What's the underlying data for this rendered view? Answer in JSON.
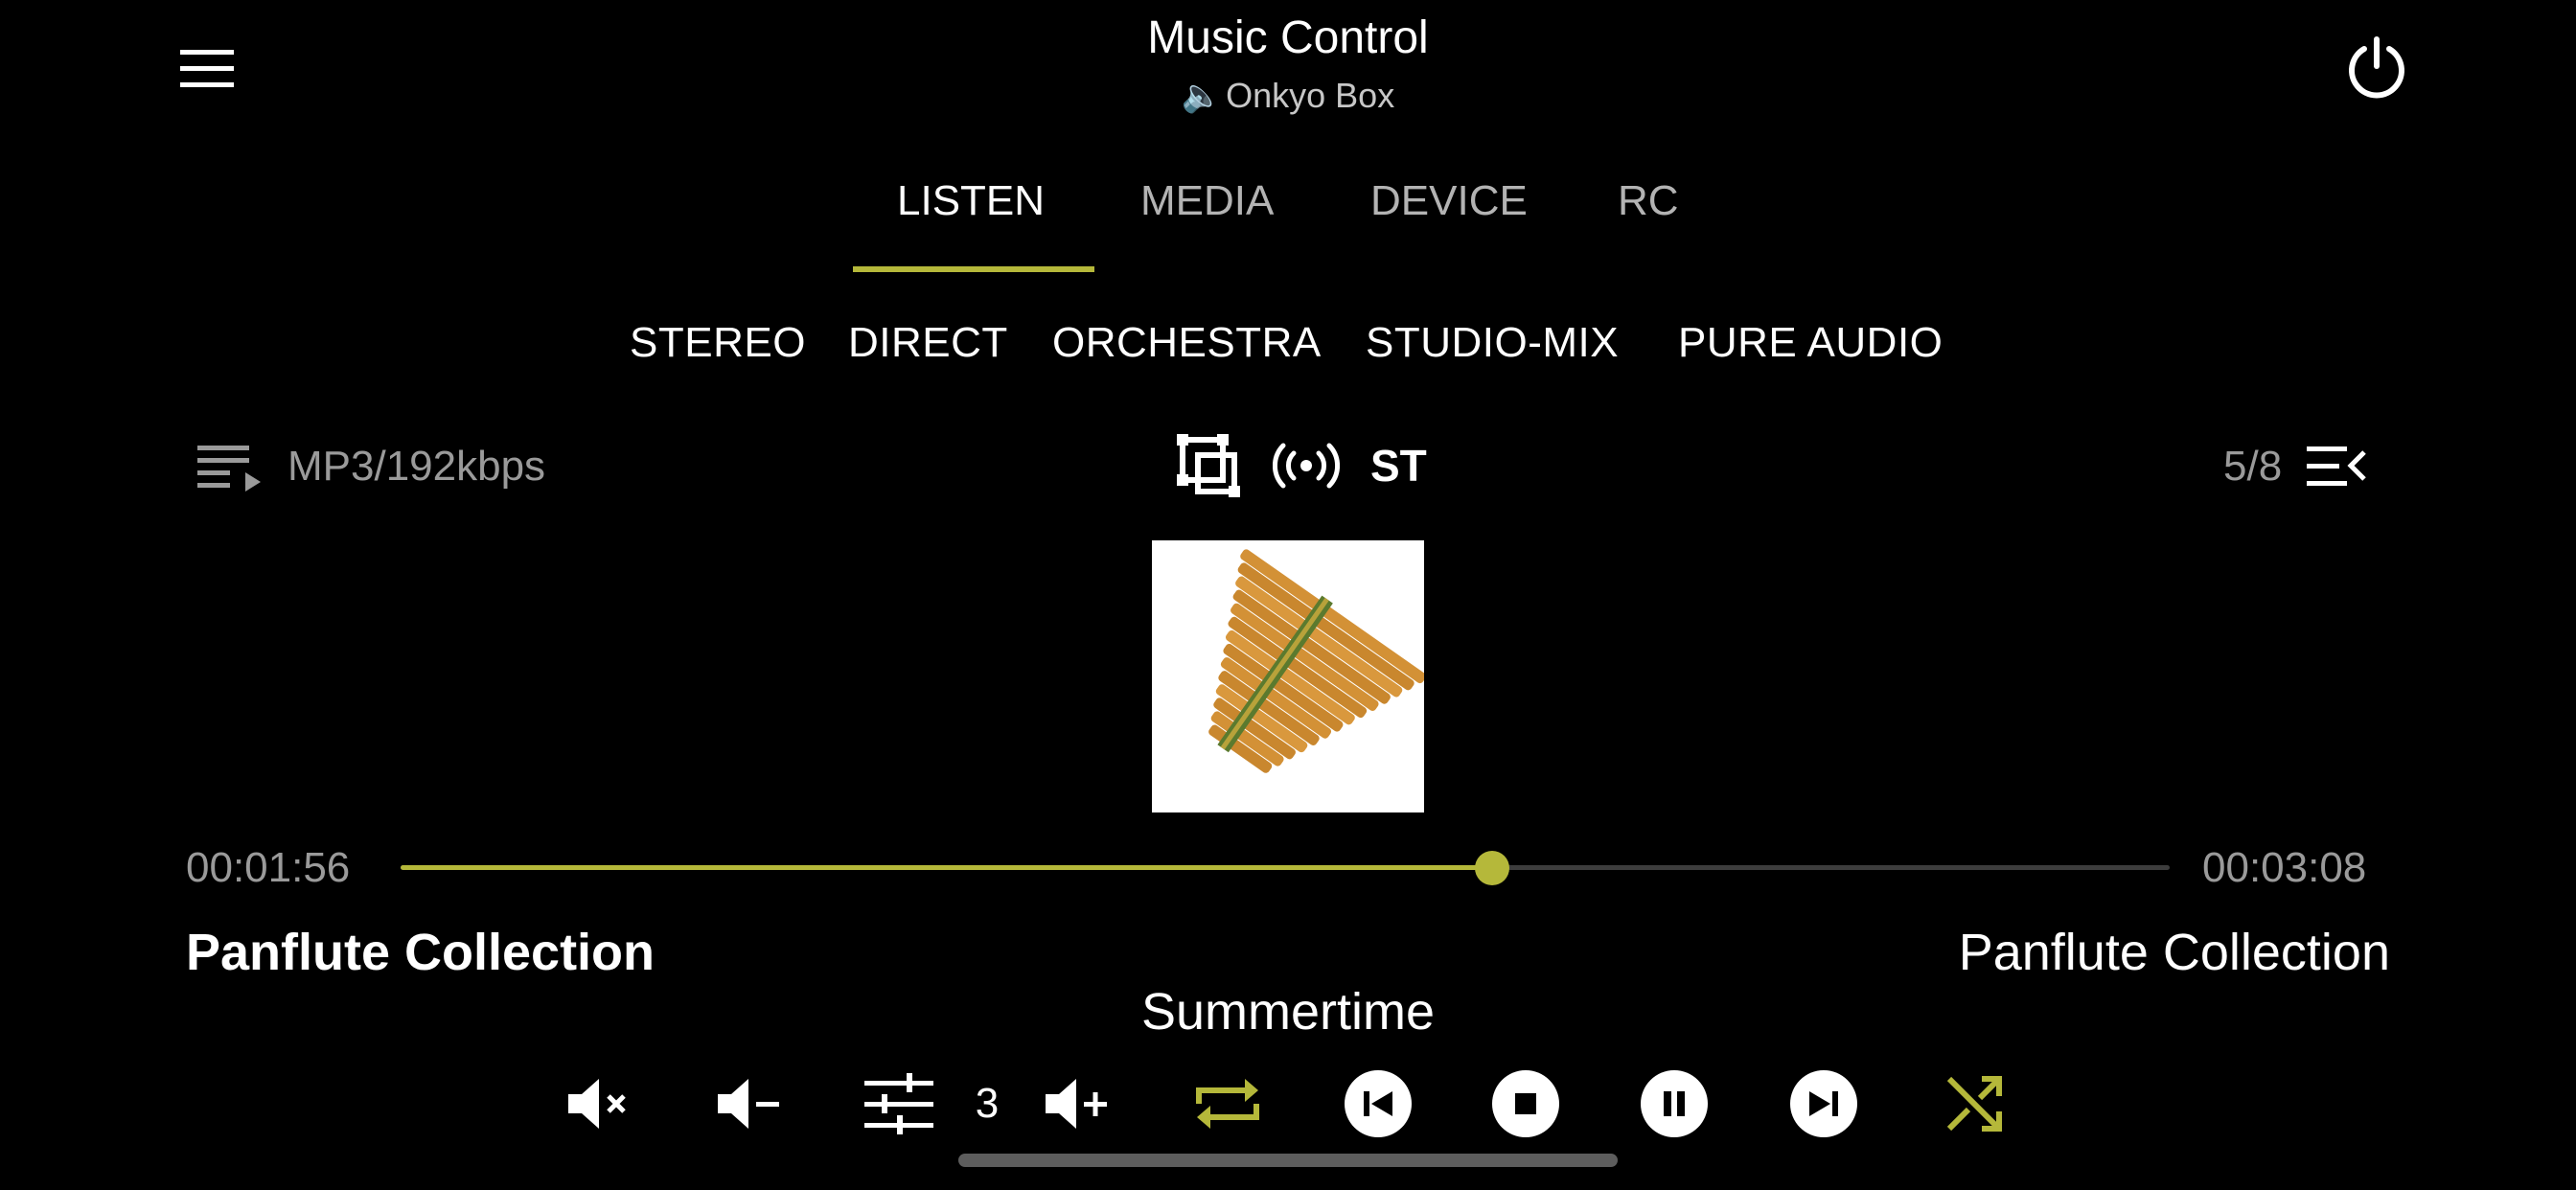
{
  "header": {
    "title": "Music Control",
    "device_name": "Onkyo Box",
    "device_icon": "speaker-icon"
  },
  "tabs": [
    {
      "label": "LISTEN",
      "active": true
    },
    {
      "label": "MEDIA",
      "active": false
    },
    {
      "label": "DEVICE",
      "active": false
    },
    {
      "label": "RC",
      "active": false
    }
  ],
  "sound_modes": [
    "STEREO",
    "DIRECT",
    "ORCHESTRA",
    "STUDIO-MIX",
    "PURE AUDIO"
  ],
  "info": {
    "format": "MP3/192kbps",
    "signal": "ST",
    "track_position": "5/8"
  },
  "playback": {
    "elapsed": "00:01:56",
    "total": "00:03:08",
    "progress_fraction": 0.617,
    "album": "Panflute Collection",
    "artist": "Panflute Collection",
    "title": "Summertime",
    "volume": "3"
  },
  "colors": {
    "accent": "#b5b83a",
    "background": "#000000",
    "text": "#ffffff",
    "muted_text": "#9a9a9a"
  }
}
